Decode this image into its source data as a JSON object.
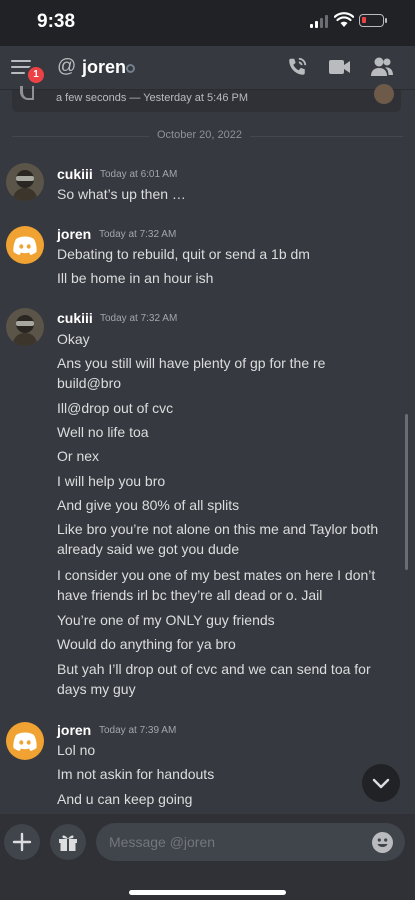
{
  "status_bar": {
    "time": "9:38"
  },
  "header": {
    "badge_count": "1",
    "at_symbol": "@",
    "title": "joren",
    "icons": [
      "menu-icon",
      "call-icon",
      "video-icon",
      "members-icon"
    ]
  },
  "call": {
    "text": "a few seconds — Yesterday at 5:46 PM"
  },
  "date_divider": "October 20, 2022",
  "messages": [
    {
      "author": "cukiii",
      "timestamp": "Today at 6:01 AM",
      "lines": [
        "So what’s up then …"
      ]
    },
    {
      "author": "joren",
      "timestamp": "Today at 7:32 AM",
      "lines": [
        "Debating to rebuild, quit or send a 1b dm",
        "Ill be home in an hour ish"
      ]
    },
    {
      "author": "cukiii",
      "timestamp": "Today at 7:32 AM",
      "lines": [
        "Okay",
        "Ans you still will have plenty of gp for the re",
        "build@bro",
        "Ill@drop out of cvc",
        "Well no life toa",
        "Or nex",
        "I will help you bro",
        "And give you 80% of all splits",
        "Like bro you’re not alone on this me and Taylor both",
        "already said we got you dude",
        "I consider you one of my best mates on here I don’t",
        "have friends irl bc they’re all dead or o. Jail",
        "You’re one of my ONLY guy friends",
        "Would do anything for ya bro",
        "But yah I’ll drop out of cvc and we can send toa for",
        "days my guy"
      ]
    },
    {
      "author": "joren",
      "timestamp": "Today at 7:39 AM",
      "lines": [
        "Lol no",
        "Im not askin for handouts",
        "And u can keep going"
      ]
    }
  ],
  "composer": {
    "placeholder": "Message @joren"
  },
  "colors": {
    "background": "#36393f",
    "status_bar": "#202225",
    "discord_avatar": "#f0a232",
    "badge": "#ed4245",
    "battery_low": "#ed4245"
  }
}
